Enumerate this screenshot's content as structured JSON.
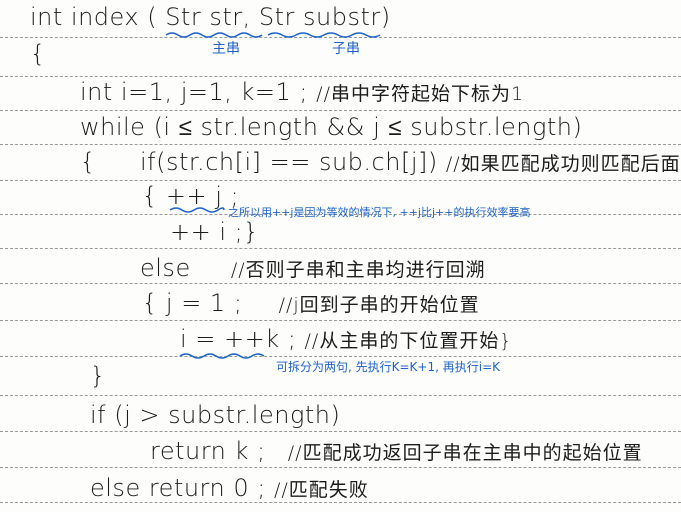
{
  "code": {
    "line1": "int  index ( Str  str, Str  substr)",
    "line2": "{",
    "line3": "int  i=1, j=1, k=1 ;",
    "line3_comment": "//串中字符起始下标为1",
    "line4": "while (i ≤ str.length && j ≤  substr.length)",
    "line5a": "{",
    "line5": "if(str.ch[i] == sub.ch[j])",
    "line5_comment": "//如果匹配成功则匹配后面",
    "line6": "{    ++ j ;",
    "line7": "++ i ;}",
    "line8": "else",
    "line8_comment": "//否则子串和主串均进行回溯",
    "line9": "{   j = 1 ;",
    "line9_comment": "//j回到子串的开始位置",
    "line10": "i = ++k ;",
    "line10_comment": "//从主串的下位置开始}",
    "line11": "}",
    "line12": "if (j > substr.length)",
    "line13": "return  k ;",
    "line13_comment": "//匹配成功返回子串在主串中的起始位置",
    "line14": "else  return  0 ;",
    "line14_comment": "//匹配失败"
  },
  "annotations": {
    "main_string": "主串",
    "sub_string": "子串",
    "increment_note": "之所以用++j是因为等效的情况下, ++j比j++的执行效率要高",
    "split_note": "可拆分为两句, 先执行K=K+1, 再执行i=K"
  },
  "colors": {
    "ink": "#1c1c1c",
    "annotation": "#1f63c9",
    "rule": "#9a9a9a"
  }
}
